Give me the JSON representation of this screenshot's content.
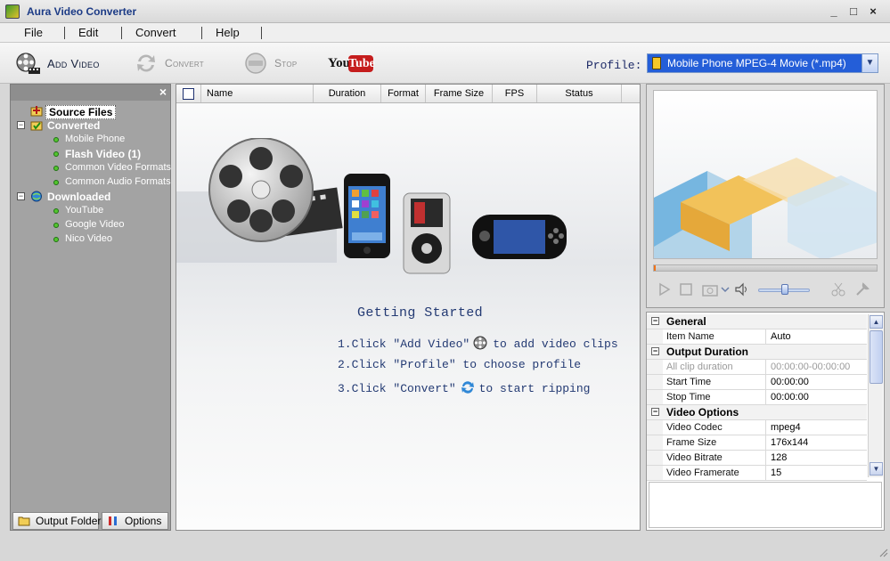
{
  "window": {
    "title": "Aura Video Converter"
  },
  "menu": {
    "items": [
      "File",
      "Edit",
      "Convert",
      "Help"
    ]
  },
  "toolbar": {
    "add_video": "Add Video",
    "convert": "Convert",
    "stop": "Stop",
    "youtube_you": "You",
    "youtube_tube": "Tube",
    "profile_label": "Profile:",
    "profile_value": "Mobile Phone MPEG-4 Movie (*.mp4)"
  },
  "tree": {
    "source_files": "Source Files",
    "converted": "Converted",
    "converted_children": [
      "Mobile Phone",
      "Flash Video (1)",
      "Common Video Formats",
      "Common Audio Formats"
    ],
    "downloaded": "Downloaded",
    "downloaded_children": [
      "YouTube",
      "Google Video",
      "Nico Video"
    ]
  },
  "left_bottom": {
    "output_folder": "Output Folder",
    "options": "Options"
  },
  "grid": {
    "columns": [
      "Name",
      "Duration",
      "Format",
      "Frame Size",
      "FPS",
      "Status"
    ]
  },
  "getting_started": {
    "title": "Getting Started",
    "step1_a": "1.Click \"Add Video\"",
    "step1_b": "to add video clips",
    "step2": "2.Click \"Profile\" to choose profile",
    "step3_a": "3.Click \"Convert\"",
    "step3_b": "to start ripping"
  },
  "properties": {
    "general": "General",
    "item_name_label": "Item Name",
    "item_name_value": "Auto",
    "output_duration": "Output Duration",
    "all_clip_label": "All clip duration",
    "all_clip_value": "00:00:00-00:00:00",
    "start_time_label": "Start Time",
    "start_time_value": "00:00:00",
    "stop_time_label": "Stop Time",
    "stop_time_value": "00:00:00",
    "video_options": "Video Options",
    "video_codec_label": "Video Codec",
    "video_codec_value": "mpeg4",
    "frame_size_label": "Frame Size",
    "frame_size_value": "176x144",
    "video_bitrate_label": "Video Bitrate",
    "video_bitrate_value": "128",
    "video_framerate_label": "Video Framerate",
    "video_framerate_value": "15"
  },
  "player": {
    "volume_level": 0.45,
    "seek_position": 0.0
  },
  "colors": {
    "title_text": "#1c3b86",
    "selection": "#245ed8",
    "youtube_red": "#c51d1d",
    "tree_bullet": "#53c52e",
    "instruction_text": "#233a73"
  }
}
